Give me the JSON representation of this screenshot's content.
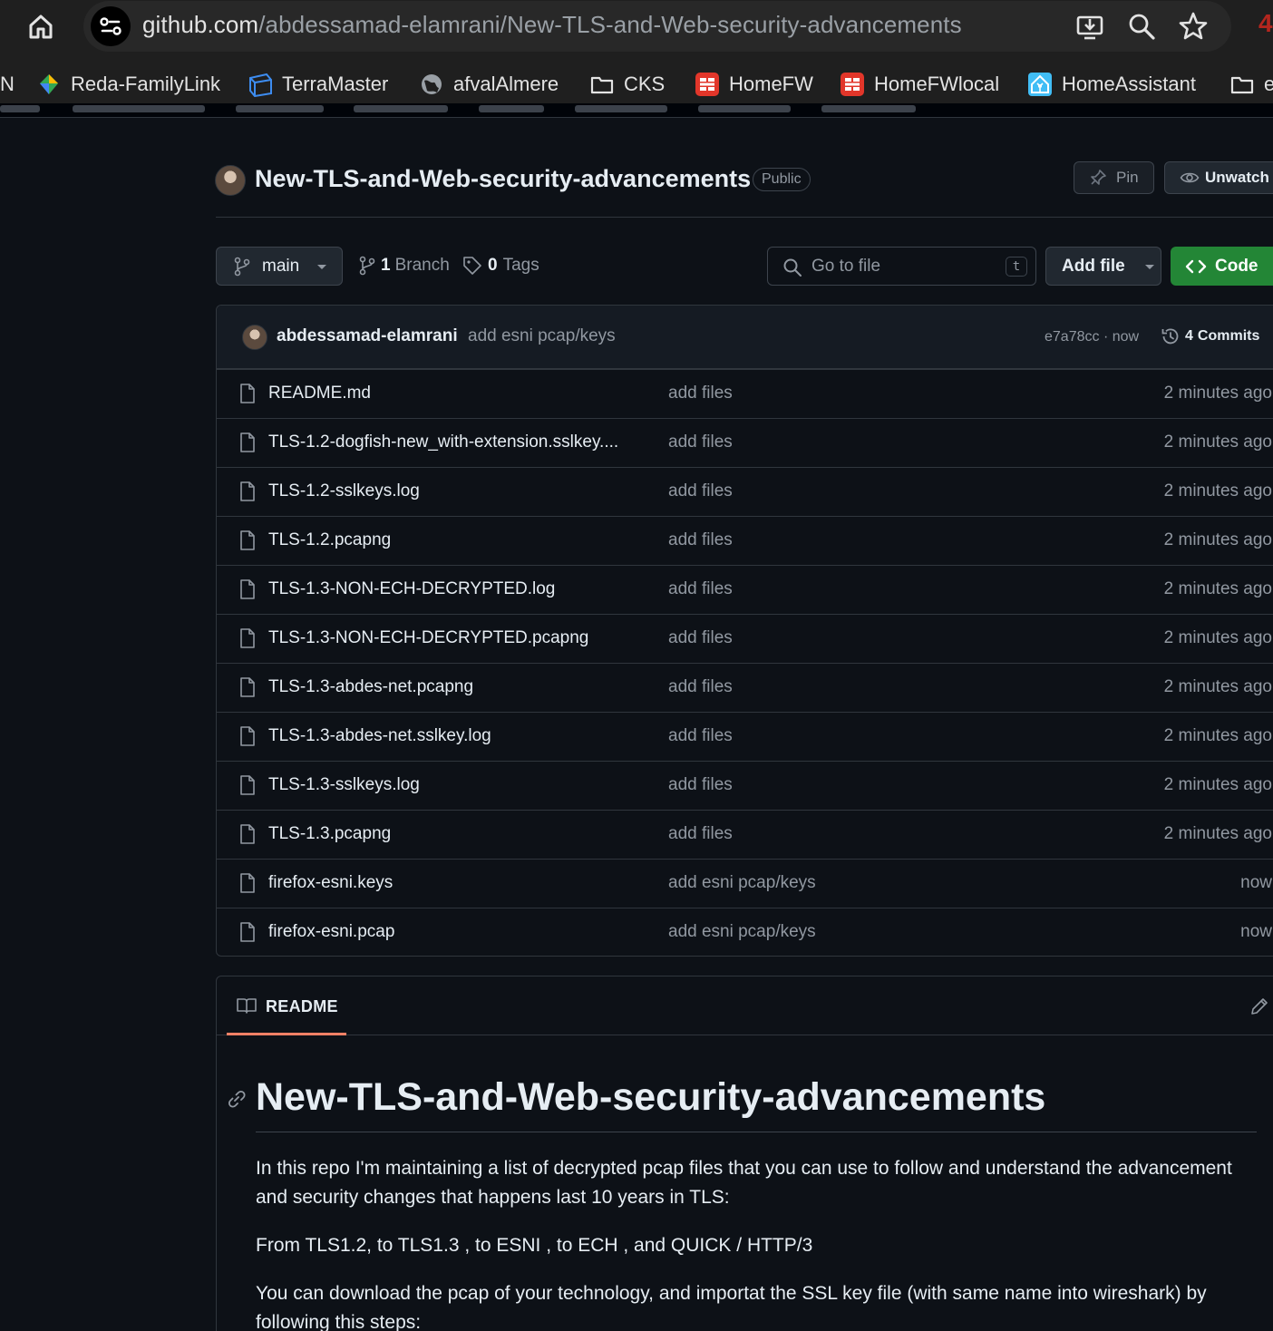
{
  "browser": {
    "url_host": "github.com",
    "url_path": "/abdessamad-elamrani/New-TLS-and-Web-security-advancements",
    "bookmarks": [
      {
        "label": "N",
        "icon": "none"
      },
      {
        "label": "Reda-FamilyLink",
        "icon": "familylink-icon"
      },
      {
        "label": "TerraMaster",
        "icon": "terramaster-icon"
      },
      {
        "label": "afvalAlmere",
        "icon": "globe-icon"
      },
      {
        "label": "CKS",
        "icon": "folder-icon"
      },
      {
        "label": "HomeFW",
        "icon": "fortinet-icon"
      },
      {
        "label": "HomeFWlocal",
        "icon": "fortinet-icon"
      },
      {
        "label": "HomeAssistant",
        "icon": "homeassistant-icon"
      },
      {
        "label": "e",
        "icon": "folder-icon"
      }
    ]
  },
  "repo": {
    "name": "New-TLS-and-Web-security-advancements",
    "visibility": "Public",
    "pin_label": "Pin",
    "unwatch_label": "Unwatch"
  },
  "toolbar": {
    "branch": "main",
    "branch_count": "1",
    "branch_label": "Branch",
    "tag_count": "0",
    "tag_label": "Tags",
    "search_placeholder": "Go to file",
    "search_kbd": "t",
    "add_file_label": "Add file",
    "code_label": "Code"
  },
  "latest_commit": {
    "author": "abdessamad-elamrani",
    "message": "add esni pcap/keys",
    "hash_time": "e7a78cc · now",
    "commits_count": "4",
    "commits_label": "Commits"
  },
  "files": [
    {
      "name": "README.md",
      "message": "add files",
      "date": "2 minutes ago"
    },
    {
      "name": "TLS-1.2-dogfish-new_with-extension.sslkey....",
      "message": "add files",
      "date": "2 minutes ago"
    },
    {
      "name": "TLS-1.2-sslkeys.log",
      "message": "add files",
      "date": "2 minutes ago"
    },
    {
      "name": "TLS-1.2.pcapng",
      "message": "add files",
      "date": "2 minutes ago"
    },
    {
      "name": "TLS-1.3-NON-ECH-DECRYPTED.log",
      "message": "add files",
      "date": "2 minutes ago"
    },
    {
      "name": "TLS-1.3-NON-ECH-DECRYPTED.pcapng",
      "message": "add files",
      "date": "2 minutes ago"
    },
    {
      "name": "TLS-1.3-abdes-net.pcapng",
      "message": "add files",
      "date": "2 minutes ago"
    },
    {
      "name": "TLS-1.3-abdes-net.sslkey.log",
      "message": "add files",
      "date": "2 minutes ago"
    },
    {
      "name": "TLS-1.3-sslkeys.log",
      "message": "add files",
      "date": "2 minutes ago"
    },
    {
      "name": "TLS-1.3.pcapng",
      "message": "add files",
      "date": "2 minutes ago"
    },
    {
      "name": "firefox-esni.keys",
      "message": "add esni pcap/keys",
      "date": "now"
    },
    {
      "name": "firefox-esni.pcap",
      "message": "add esni pcap/keys",
      "date": "now"
    }
  ],
  "readme": {
    "tab_label": "README",
    "heading": "New-TLS-and-Web-security-advancements",
    "p1": "In this repo I'm maintaining a list of decrypted pcap files that you can use to follow and understand the advancement and security changes that happens last 10 years in TLS:",
    "p2": "From TLS1.2, to TLS1.3 , to ESNI , to ECH , and QUICK / HTTP/3",
    "p3": "You can download the pcap of your technology, and importat the SSL key file (with same name into wireshark) by following this steps:"
  },
  "colors": {
    "accent_green": "#238636",
    "tab_underline": "#f78166",
    "bookmark_red": "#e2362a",
    "bookmark_blue": "#3d8cf0"
  }
}
